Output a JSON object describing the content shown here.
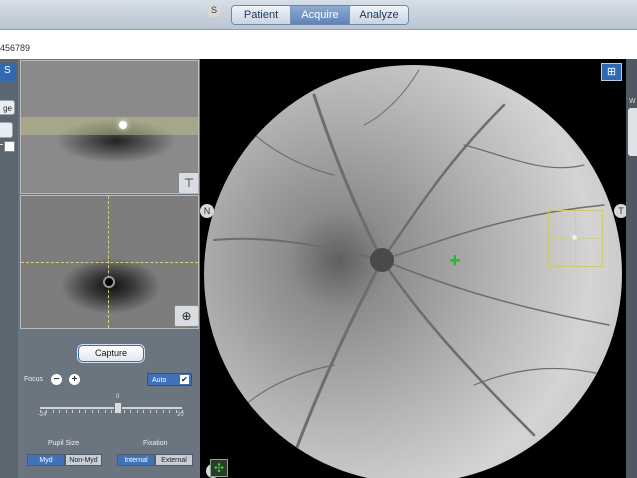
{
  "header": {
    "tabs": [
      {
        "label": "Patient",
        "active": false
      },
      {
        "label": "Acquire",
        "active": true
      },
      {
        "label": "Analyze",
        "active": false
      }
    ],
    "patient_id_fragment": "456789"
  },
  "left_panel": {
    "tab_glyph": "S",
    "button_fragment": "ge"
  },
  "controls": {
    "capture_label": "Capture",
    "focus_label": "Focus",
    "focus_minus": "−",
    "focus_plus": "+",
    "auto_label": "Auto",
    "auto_checked": "✔",
    "focus_min": "-24",
    "focus_max": "20",
    "focus_value": "0",
    "pupil_size_label": "Pupil Size",
    "pupil_options": [
      "Myd",
      "Non-Myd"
    ],
    "fixation_label": "Fixation",
    "fixation_options": [
      "Internal",
      "External"
    ]
  },
  "viewer": {
    "orientation": {
      "superior": "S",
      "nasal": "N",
      "temporal": "T",
      "inferior": "I"
    }
  },
  "right_panel": {
    "label_fragment": "W"
  },
  "colors": {
    "accent_blue": "#3f72b8",
    "target_yellow": "#cfc96e",
    "center_marker_green": "#2bb33a"
  }
}
